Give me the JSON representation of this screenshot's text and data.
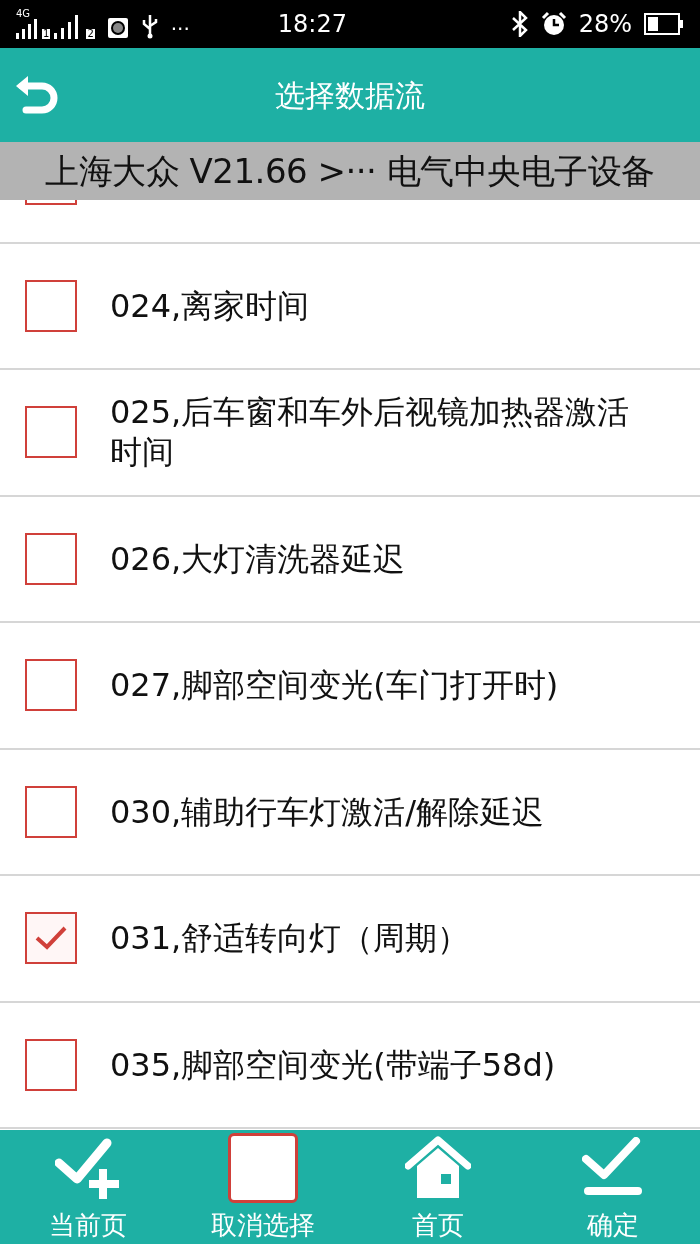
{
  "status_bar": {
    "network": "4G",
    "sim_1": "1",
    "sim_2": "2",
    "more": "···",
    "time": "18:27",
    "battery": "28%"
  },
  "header": {
    "title": "选择数据流"
  },
  "breadcrumb": "上海大众 V21.66 >··· 电气中央电子设备",
  "items": [
    {
      "kind": "cut-off"
    },
    {
      "kind": "option",
      "label": "024,离家时间",
      "checked": false
    },
    {
      "kind": "option",
      "label": "025,后车窗和车外后视镜加热器激活时间",
      "checked": false
    },
    {
      "kind": "option",
      "label": "026,大灯清洗器延迟",
      "checked": false
    },
    {
      "kind": "option",
      "label": "027,脚部空间变光(车门打开时)",
      "checked": false
    },
    {
      "kind": "option",
      "label": "030,辅助行车灯激活/解除延迟",
      "checked": false
    },
    {
      "kind": "option",
      "label": "031,舒适转向灯（周期）",
      "checked": true
    },
    {
      "kind": "option",
      "label": "035,脚部空间变光(带端子58d)",
      "checked": false
    }
  ],
  "bottom_bar": [
    {
      "kind": "check-plus",
      "label": "当前页"
    },
    {
      "kind": "box",
      "label": "取消选择"
    },
    {
      "kind": "home",
      "label": "首页"
    },
    {
      "kind": "check-line",
      "label": "确定"
    }
  ]
}
